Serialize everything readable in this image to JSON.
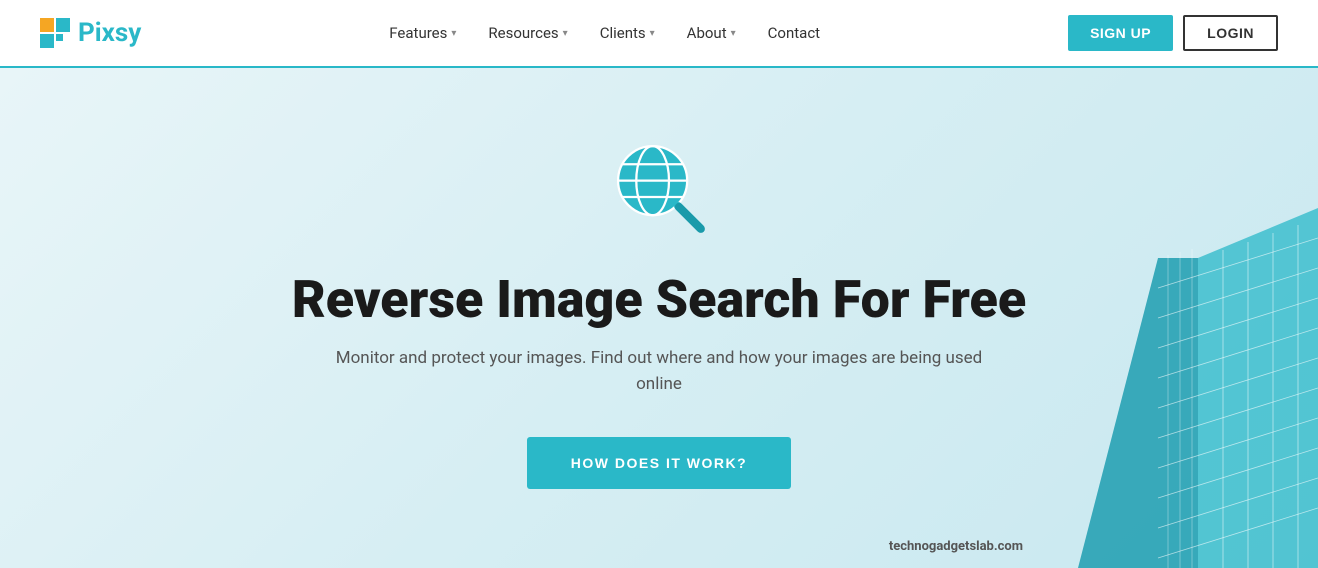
{
  "brand": {
    "name": "Pixsy",
    "logo_color": "#2ab8c8",
    "logo_orange": "#f5a623"
  },
  "navbar": {
    "links": [
      {
        "label": "Features",
        "has_dropdown": true
      },
      {
        "label": "Resources",
        "has_dropdown": true
      },
      {
        "label": "Clients",
        "has_dropdown": true
      },
      {
        "label": "About",
        "has_dropdown": true
      },
      {
        "label": "Contact",
        "has_dropdown": false
      }
    ],
    "signup_label": "SIGN UP",
    "login_label": "LOGIN"
  },
  "hero": {
    "title": "Reverse Image Search For Free",
    "subtitle": "Monitor and protect your images. Find out where and how your images are being used online",
    "cta_label": "HOW DOES IT WORK?",
    "watermark": "technogadgetslab.com"
  }
}
